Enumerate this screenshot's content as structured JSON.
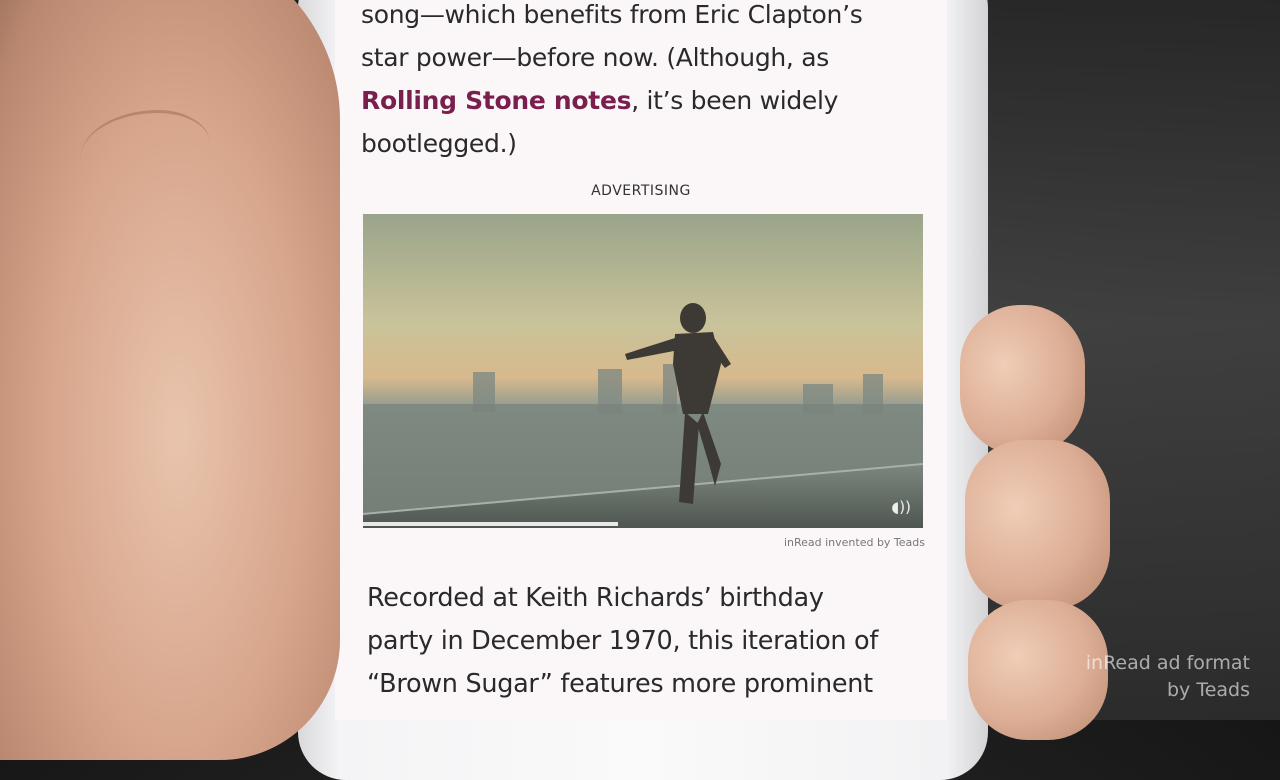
{
  "article": {
    "para1_line1": "song—which benefits from Eric Clapton’s",
    "para1_line2": "star power—before now. (Although, as",
    "para1_link": "Rolling Stone notes",
    "para1_line3_rest": ", it’s been widely",
    "para1_line4": "bootlegged.)",
    "para2_line1": "Recorded at Keith Richards’ birthday",
    "para2_line2": "party in December 1970, this iteration of",
    "para2_line3": "“Brown Sugar” features more prominent",
    "link_color": "#7a1f4d"
  },
  "ad": {
    "label": "ADVERTISING",
    "caption": "inRead invented by Teads",
    "sound_icon": "speaker-icon"
  },
  "watermark": {
    "line1": "inRead ad format",
    "line2": "by Teads"
  }
}
